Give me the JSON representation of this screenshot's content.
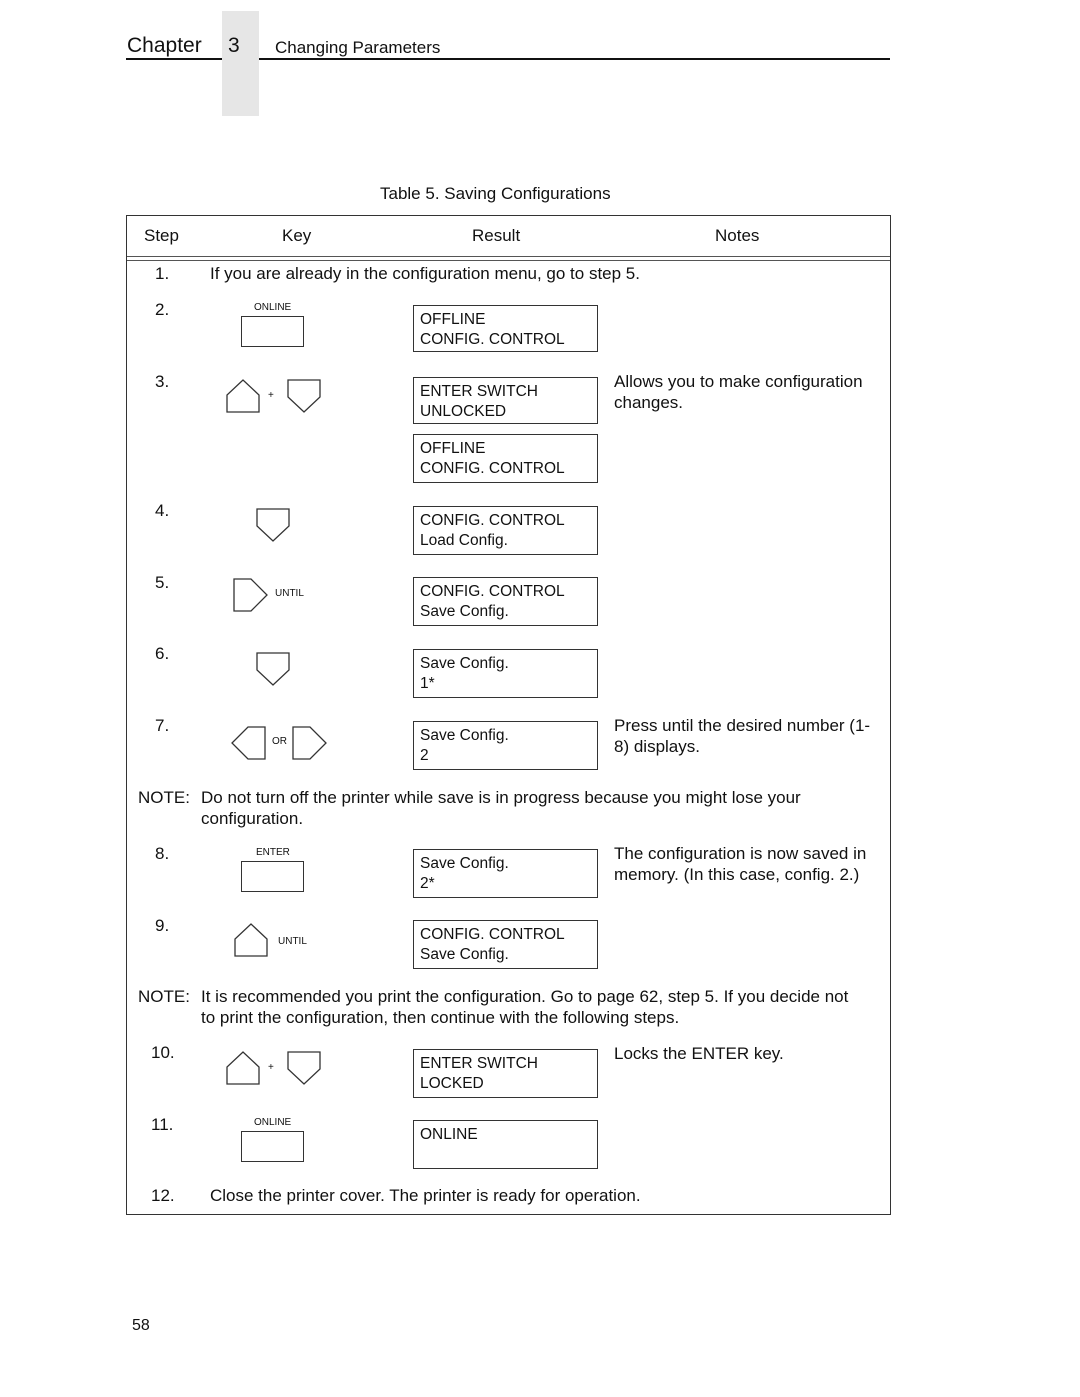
{
  "header": {
    "chapter_word": "Chapter",
    "chapter_number": "3",
    "chapter_title": "Changing Parameters"
  },
  "table": {
    "caption": "Table 5. Saving Configurations",
    "columns": [
      "Step",
      "Key",
      "Result",
      "Notes"
    ],
    "rows": [
      {
        "step": "1.",
        "text": "If you are already in the configuration menu, go to step 5."
      },
      {
        "step": "2.",
        "key_label": "ONLINE",
        "key_icon": "rectangle-key",
        "result": [
          "OFFLINE",
          "CONFIG. CONTROL"
        ],
        "notes": ""
      },
      {
        "step": "3.",
        "key_label": "+",
        "key_icon": "up-arrow-key-plus-down-arrow-key",
        "result": [
          "ENTER SWITCH",
          "UNLOCKED"
        ],
        "result2": [
          "OFFLINE",
          "CONFIG. CONTROL"
        ],
        "notes": "Allows you to make configuration changes."
      },
      {
        "step": "4.",
        "key_icon": "down-arrow-key",
        "result": [
          "CONFIG. CONTROL",
          "Load Config."
        ],
        "notes": ""
      },
      {
        "step": "5.",
        "key_label": "UNTIL",
        "key_icon": "right-arrow-key",
        "result": [
          "CONFIG. CONTROL",
          "Save Config."
        ],
        "notes": ""
      },
      {
        "step": "6.",
        "key_icon": "down-arrow-key",
        "result": [
          "Save Config.",
          "1*"
        ],
        "notes": ""
      },
      {
        "step": "7.",
        "key_label": "OR",
        "key_icon": "left-arrow-key-or-right-arrow-key",
        "result": [
          "Save Config.",
          "2"
        ],
        "notes": "Press until the desired number (1-8) displays."
      },
      {
        "step": "8.",
        "key_label": "ENTER",
        "key_icon": "rectangle-key",
        "result": [
          "Save Config.",
          "2*"
        ],
        "notes": "The configuration is now saved in memory. (In this case, config. 2.)"
      },
      {
        "step": "9.",
        "key_label": "UNTIL",
        "key_icon": "up-arrow-key",
        "result": [
          "CONFIG. CONTROL",
          "Save Config."
        ],
        "notes": ""
      },
      {
        "step": "10.",
        "key_label": "+",
        "key_icon": "up-arrow-key-plus-down-arrow-key",
        "result": [
          "ENTER SWITCH",
          "LOCKED"
        ],
        "notes": "Locks the ENTER key."
      },
      {
        "step": "11.",
        "key_label": "ONLINE",
        "key_icon": "rectangle-key",
        "result": [
          "ONLINE",
          ""
        ],
        "notes": ""
      },
      {
        "step": "12.",
        "text": "Close the printer cover. The printer is ready for operation."
      }
    ],
    "notes": [
      {
        "label": "NOTE:",
        "line1": "Do not turn off the printer while save is in progress because you might lose your",
        "line2": "configuration."
      },
      {
        "label": "NOTE:",
        "line1": "It is recommended you print the configuration. Go to page 62, step 5. If you decide not",
        "line2": "to print the configuration, then continue with the following steps."
      }
    ]
  },
  "footer": {
    "page_number": "58"
  }
}
